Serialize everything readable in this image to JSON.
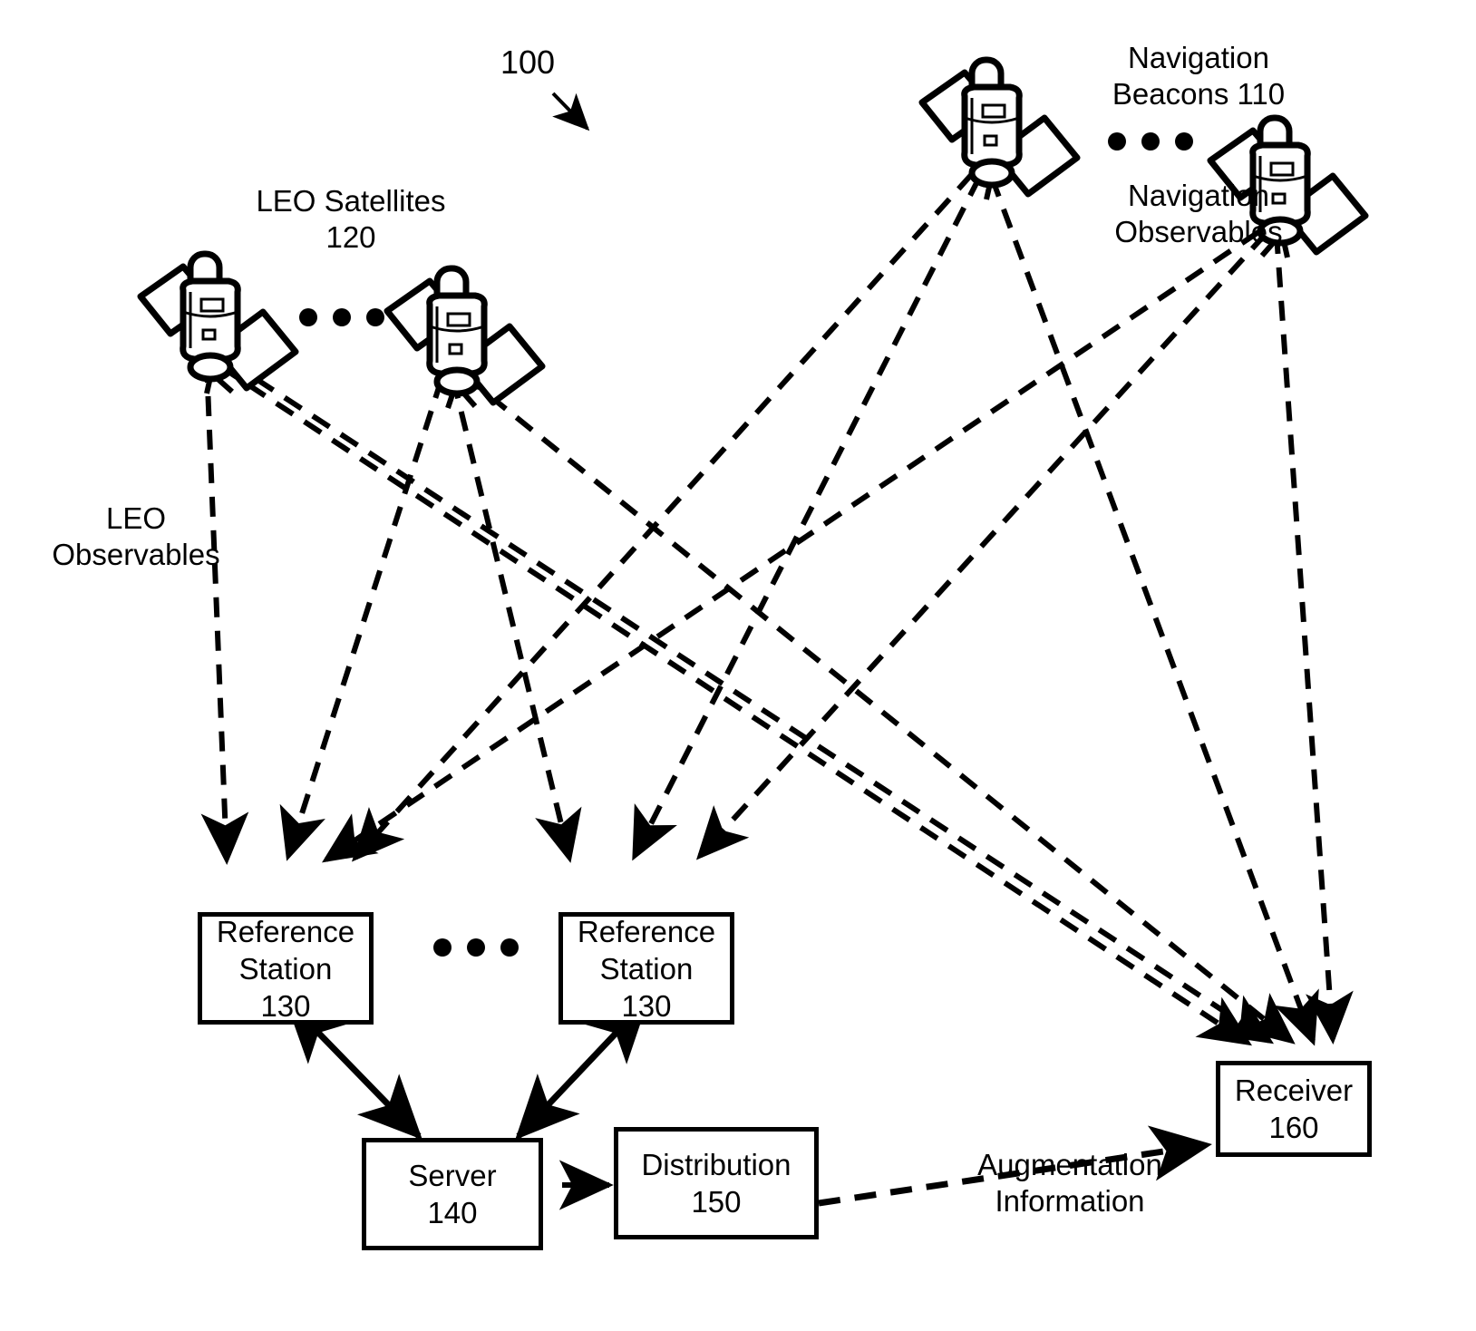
{
  "figure": {
    "number": "100",
    "pointer_icon": "down-right-arrow-icon"
  },
  "labels": {
    "nav_beacons": "Navigation\nBeacons 110",
    "nav_observables": "Navigation\nObservables",
    "leo_satellites": "LEO Satellites\n120",
    "leo_observables": "LEO\nObservables",
    "augmentation_information": "Augmentation\nInformation"
  },
  "nodes": {
    "reference_station_left": "Reference\nStation\n130",
    "reference_station_right": "Reference\nStation\n130",
    "server": "Server\n140",
    "distribution": "Distribution\n150",
    "receiver": "Receiver\n160"
  },
  "icons": {
    "satellite": "satellite-icon",
    "ellipsis": "ellipsis-dots-icon"
  },
  "colors": {
    "stroke": "#000000",
    "background": "#ffffff"
  },
  "counts": {
    "navigation_beacons_shown": 2,
    "leo_satellites_shown": 2,
    "reference_stations_shown": 2
  }
}
